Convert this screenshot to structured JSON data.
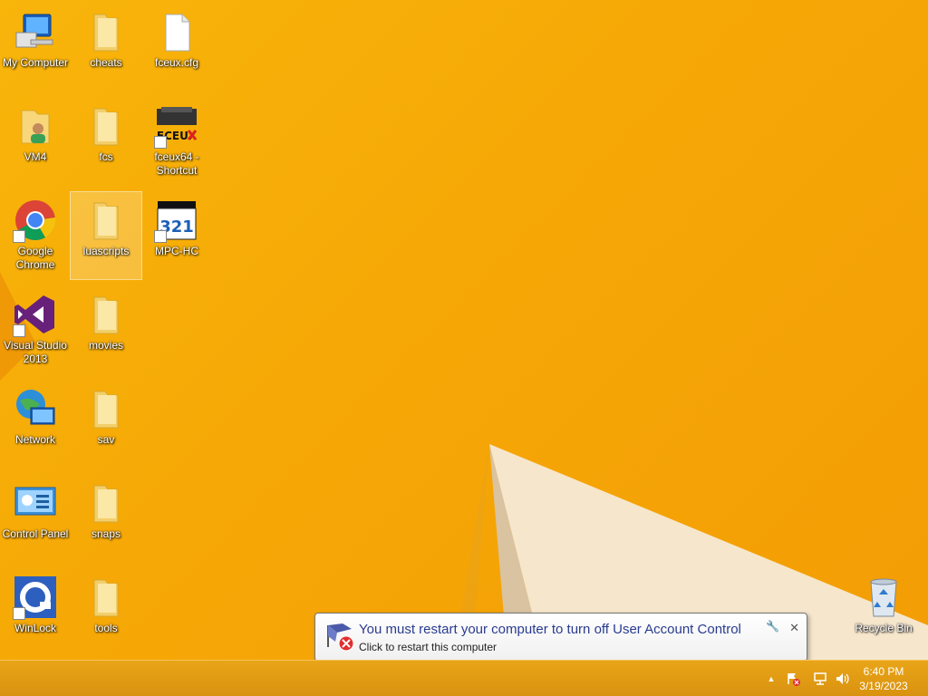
{
  "desktop": {
    "icons": [
      {
        "name": "my-computer",
        "label": "My Computer"
      },
      {
        "name": "cheats",
        "label": "cheats"
      },
      {
        "name": "fceux-cfg",
        "label": "fceux.cfg"
      },
      {
        "name": "vm4",
        "label": "VM4"
      },
      {
        "name": "fcs",
        "label": "fcs"
      },
      {
        "name": "fceux64-shortcut",
        "label": "fceux64 - Shortcut"
      },
      {
        "name": "google-chrome",
        "label": "Google Chrome"
      },
      {
        "name": "luascripts",
        "label": "luascripts"
      },
      {
        "name": "mpc-hc",
        "label": "MPC-HC"
      },
      {
        "name": "visual-studio-2013",
        "label": "Visual Studio 2013"
      },
      {
        "name": "movies",
        "label": "movies"
      },
      {
        "name": "network",
        "label": "Network"
      },
      {
        "name": "sav",
        "label": "sav"
      },
      {
        "name": "control-panel",
        "label": "Control Panel"
      },
      {
        "name": "snaps",
        "label": "snaps"
      },
      {
        "name": "winlock",
        "label": "WinLock"
      },
      {
        "name": "tools",
        "label": "tools"
      },
      {
        "name": "recycle-bin",
        "label": "Recycle Bin"
      }
    ],
    "selected_icon": "luascripts"
  },
  "fceux_logo_text": "FCEUX",
  "mpc_logo_text": "321",
  "balloon": {
    "title": "You must restart your computer to turn off User Account Control",
    "text": "Click to restart this computer",
    "close_label": "✕",
    "options_label": "🔧"
  },
  "taskbar": {
    "tray_overflow_label": "▲",
    "time": "6:40 PM",
    "date": "3/19/2023"
  },
  "colors": {
    "wallpaper": "#f6a806",
    "balloon_title": "#2a3b90"
  }
}
